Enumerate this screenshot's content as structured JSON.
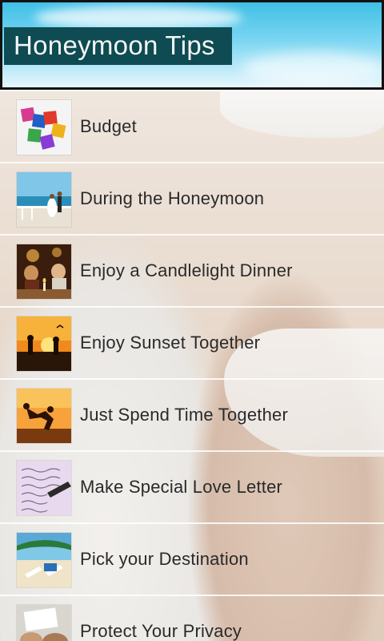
{
  "header": {
    "title": "Honeymoon Tips"
  },
  "tips": [
    {
      "label": "Budget",
      "icon": "budget-blocks-icon"
    },
    {
      "label": "During the Honeymoon",
      "icon": "couple-on-pier-icon"
    },
    {
      "label": "Enjoy a Candlelight Dinner",
      "icon": "candlelight-dinner-icon"
    },
    {
      "label": "Enjoy Sunset Together",
      "icon": "sunset-couple-icon"
    },
    {
      "label": "Just Spend Time Together",
      "icon": "couple-jumping-sunset-icon"
    },
    {
      "label": "Make Special Love Letter",
      "icon": "love-letter-icon"
    },
    {
      "label": "Pick your Destination",
      "icon": "beach-chairs-icon"
    },
    {
      "label": "Protect Your Privacy",
      "icon": "privacy-hands-icon"
    }
  ]
}
